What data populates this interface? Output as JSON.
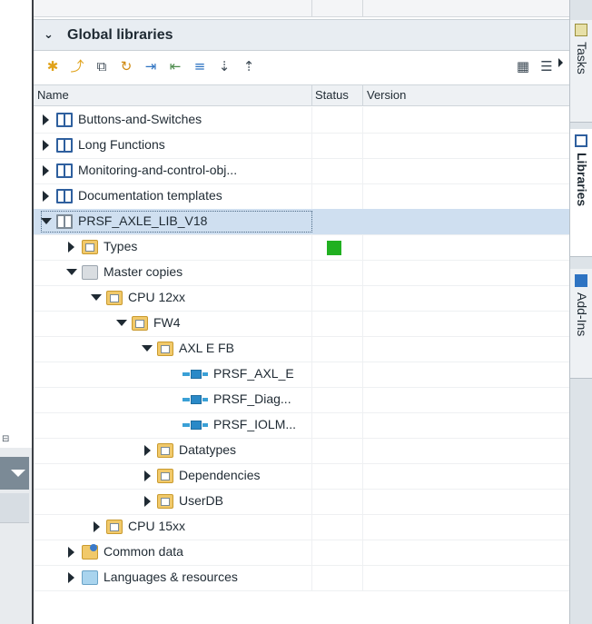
{
  "section": {
    "title": "Global libraries"
  },
  "columns": {
    "name": "Name",
    "status": "Status",
    "version": "Version"
  },
  "toolbar": {
    "icons": [
      "new-library-icon",
      "open-library-icon",
      "copy-icon",
      "update-icon",
      "export-icon",
      "import-icon",
      "database-icon",
      "sort-descending-icon",
      "sort-ascending-icon"
    ],
    "right_icons": [
      "library-view-icon",
      "list-view-icon"
    ]
  },
  "tree": {
    "rows": [
      {
        "label": "Buttons-and-Switches",
        "icon": "book-icon",
        "expander": "collapsed",
        "status": ""
      },
      {
        "label": "Long Functions",
        "icon": "book-icon",
        "expander": "collapsed",
        "status": ""
      },
      {
        "label": "Monitoring-and-control-obj...",
        "icon": "book-icon",
        "expander": "collapsed",
        "status": ""
      },
      {
        "label": "Documentation templates",
        "icon": "book-icon",
        "expander": "collapsed",
        "status": ""
      },
      {
        "label": "PRSF_AXLE_LIB_V18",
        "icon": "book-grey-icon",
        "expander": "expanded",
        "status": "",
        "selected": true
      },
      {
        "label": "Types",
        "icon": "types-folder-icon",
        "expander": "collapsed",
        "status": "green"
      },
      {
        "label": "Master copies",
        "icon": "folder-icon",
        "expander": "expanded",
        "status": ""
      },
      {
        "label": "CPU 12xx",
        "icon": "folder-icon",
        "expander": "expanded",
        "status": ""
      },
      {
        "label": "FW4",
        "icon": "folder-icon",
        "expander": "expanded",
        "status": ""
      },
      {
        "label": "AXL E FB",
        "icon": "folder-icon",
        "expander": "expanded",
        "status": ""
      },
      {
        "label": "PRSF_AXL_E",
        "icon": "function-block-icon",
        "expander": "none",
        "status": ""
      },
      {
        "label": "PRSF_Diag...",
        "icon": "function-block-icon",
        "expander": "none",
        "status": ""
      },
      {
        "label": "PRSF_IOLM...",
        "icon": "function-block-icon",
        "expander": "none",
        "status": ""
      },
      {
        "label": "Datatypes",
        "icon": "folder-icon",
        "expander": "collapsed",
        "status": ""
      },
      {
        "label": "Dependencies",
        "icon": "folder-icon",
        "expander": "collapsed",
        "status": ""
      },
      {
        "label": "UserDB",
        "icon": "folder-icon",
        "expander": "collapsed",
        "status": ""
      },
      {
        "label": "CPU 15xx",
        "icon": "folder-icon",
        "expander": "collapsed",
        "status": ""
      },
      {
        "label": "Common data",
        "icon": "common-data-icon",
        "expander": "collapsed",
        "status": ""
      },
      {
        "label": "Languages & resources",
        "icon": "languages-icon",
        "expander": "collapsed",
        "status": ""
      }
    ]
  },
  "right_tabs": [
    {
      "label": "Tasks",
      "icon": "tasks-icon"
    },
    {
      "label": "Libraries",
      "icon": "libraries-icon",
      "active": true
    },
    {
      "label": "Add-Ins",
      "icon": "add-ins-icon"
    }
  ],
  "colors": {
    "status_green": "#21b021",
    "selection": "#cfdff0",
    "header_bg": "#e8edf2"
  }
}
